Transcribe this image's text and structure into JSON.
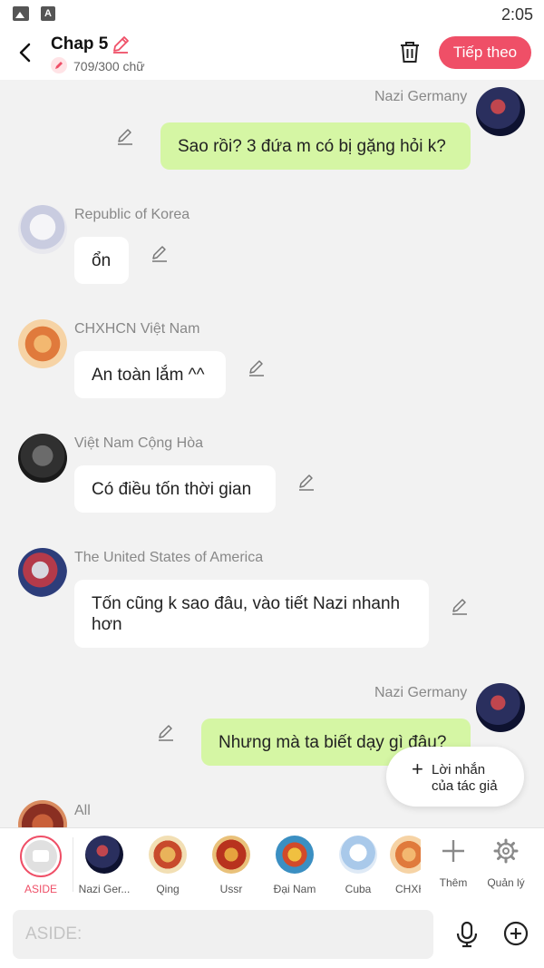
{
  "status": {
    "time": "2:05"
  },
  "header": {
    "title": "Chap 5",
    "word_count": "709/300 chữ",
    "next_label": "Tiếp theo"
  },
  "messages": [
    {
      "name": "Nazi Germany",
      "text": "Sao rồi? 3 đứa m có bị gặng hỏi k?",
      "side": "right"
    },
    {
      "name": "Republic of Korea",
      "text": "ổn",
      "side": "left"
    },
    {
      "name": "CHXHCN Việt Nam",
      "text": "An toàn lắm ^^",
      "side": "left"
    },
    {
      "name": "Việt Nam Cộng Hòa",
      "text": "Có điều tốn thời gian",
      "side": "left"
    },
    {
      "name": "The United States of America",
      "text": "Tốn cũng k sao đâu, vào tiết Nazi nhanh hơn",
      "side": "left"
    },
    {
      "name": "Nazi Germany",
      "text": "Nhưng mà ta biết dạy gì đâu?",
      "side": "right"
    },
    {
      "name": "All",
      "text": "",
      "side": "left"
    }
  ],
  "author_note": {
    "line1": "Lời nhắn",
    "line2": "của tác giả"
  },
  "characters": [
    {
      "label": "ASIDE"
    },
    {
      "label": "Nazi Ger..."
    },
    {
      "label": "Qing"
    },
    {
      "label": "Ussr"
    },
    {
      "label": "Đại Nam"
    },
    {
      "label": "Cuba"
    },
    {
      "label": "CHXH"
    }
  ],
  "tools": {
    "add_label": "Thêm",
    "manage_label": "Quản lý"
  },
  "input": {
    "placeholder": "ASIDE:"
  },
  "colors": {
    "accent": "#ef4f67",
    "out_bubble": "#d5f6a4",
    "in_bubble": "#ffffff",
    "background": "#f2f2f2"
  }
}
